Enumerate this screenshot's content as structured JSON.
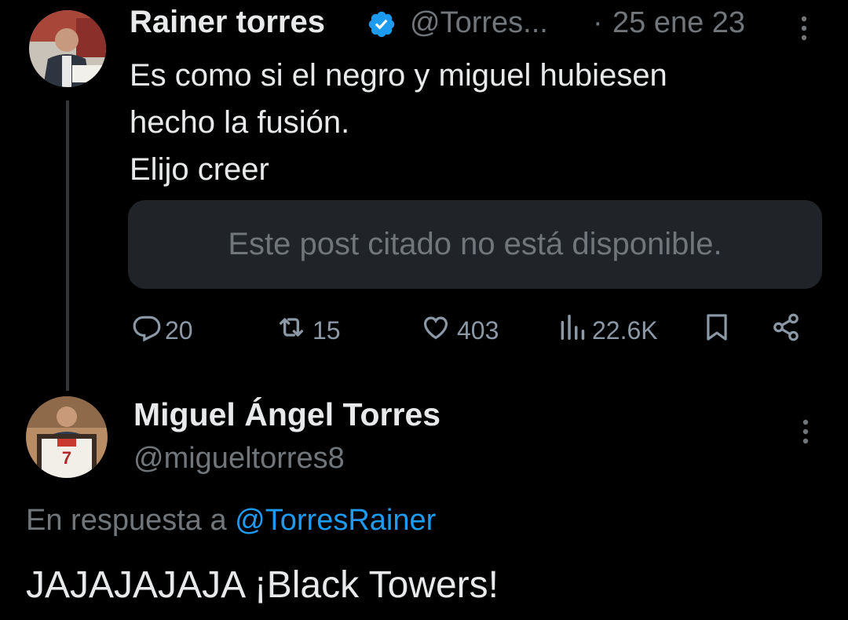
{
  "parent_tweet": {
    "author_name": "Rainer torres",
    "handle": "@Torres...",
    "separator": "·",
    "date": "25 ene 23",
    "text": "Es como si el negro y miguel hubiesen\nhecho la fusión.\nElijo creer",
    "quote_unavailable": "Este post citado no está disponible.",
    "actions": {
      "replies": "20",
      "reposts": "15",
      "likes": "403",
      "views": "22.6K"
    }
  },
  "reply_tweet": {
    "author_name": "Miguel Ángel Torres",
    "handle": "@migueltorres8",
    "reply_prefix": "En respuesta a",
    "reply_mention": "@TorresRainer",
    "text": "JAJAJAJAJA ¡Black Towers!"
  },
  "colors": {
    "background": "#000000",
    "text": "#e7e9ea",
    "muted": "#71767b",
    "accent": "#1d9bf0",
    "quote_bg": "#202327"
  },
  "icons": [
    "verified-badge-icon",
    "more-icon",
    "reply-icon",
    "repost-icon",
    "like-icon",
    "views-icon",
    "bookmark-icon",
    "share-icon"
  ]
}
